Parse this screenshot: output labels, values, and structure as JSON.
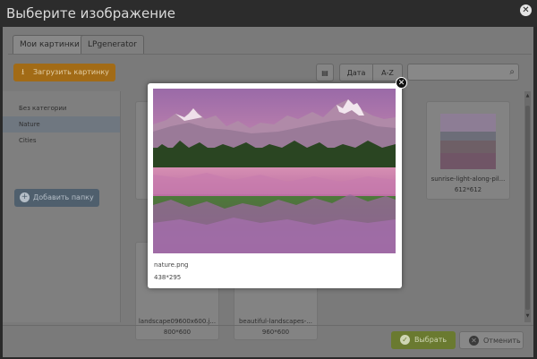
{
  "window": {
    "title": "Выберите изображение",
    "close": "✕"
  },
  "tabs": [
    {
      "label": "Мои картинки",
      "active": true
    },
    {
      "label": "LPgenerator",
      "active": false
    }
  ],
  "toolbar": {
    "upload_icon": "upload-icon",
    "upload_label": "Загрузить картинку",
    "view_icon": "grid-icon",
    "sort_date": "Дата",
    "sort_az": "A-Z",
    "search_placeholder": ""
  },
  "sidebar": {
    "categories": [
      {
        "label": "Без категории",
        "selected": false
      },
      {
        "label": "Nature",
        "selected": true
      },
      {
        "label": "Cities",
        "selected": false
      }
    ],
    "add_folder_label": "Добавить папку"
  },
  "images": [
    {
      "name": "sunrise-light-along-pil...",
      "size": "612*612"
    },
    {
      "name": "landscape09600x600.j...",
      "size": "800*600"
    },
    {
      "name": "beautiful-landscapes-...",
      "size": "960*600"
    }
  ],
  "preview": {
    "name": "nature.png",
    "dims": "438*295",
    "close": "✕"
  },
  "footer": {
    "select_label": "Выбрать",
    "select_icon": "check-icon",
    "cancel_label": "Отменить",
    "cancel_icon": "cancel-icon"
  },
  "colors": {
    "upload": "#a26b16",
    "select": "#6a7a30",
    "add_folder": "#4f5f6d"
  }
}
